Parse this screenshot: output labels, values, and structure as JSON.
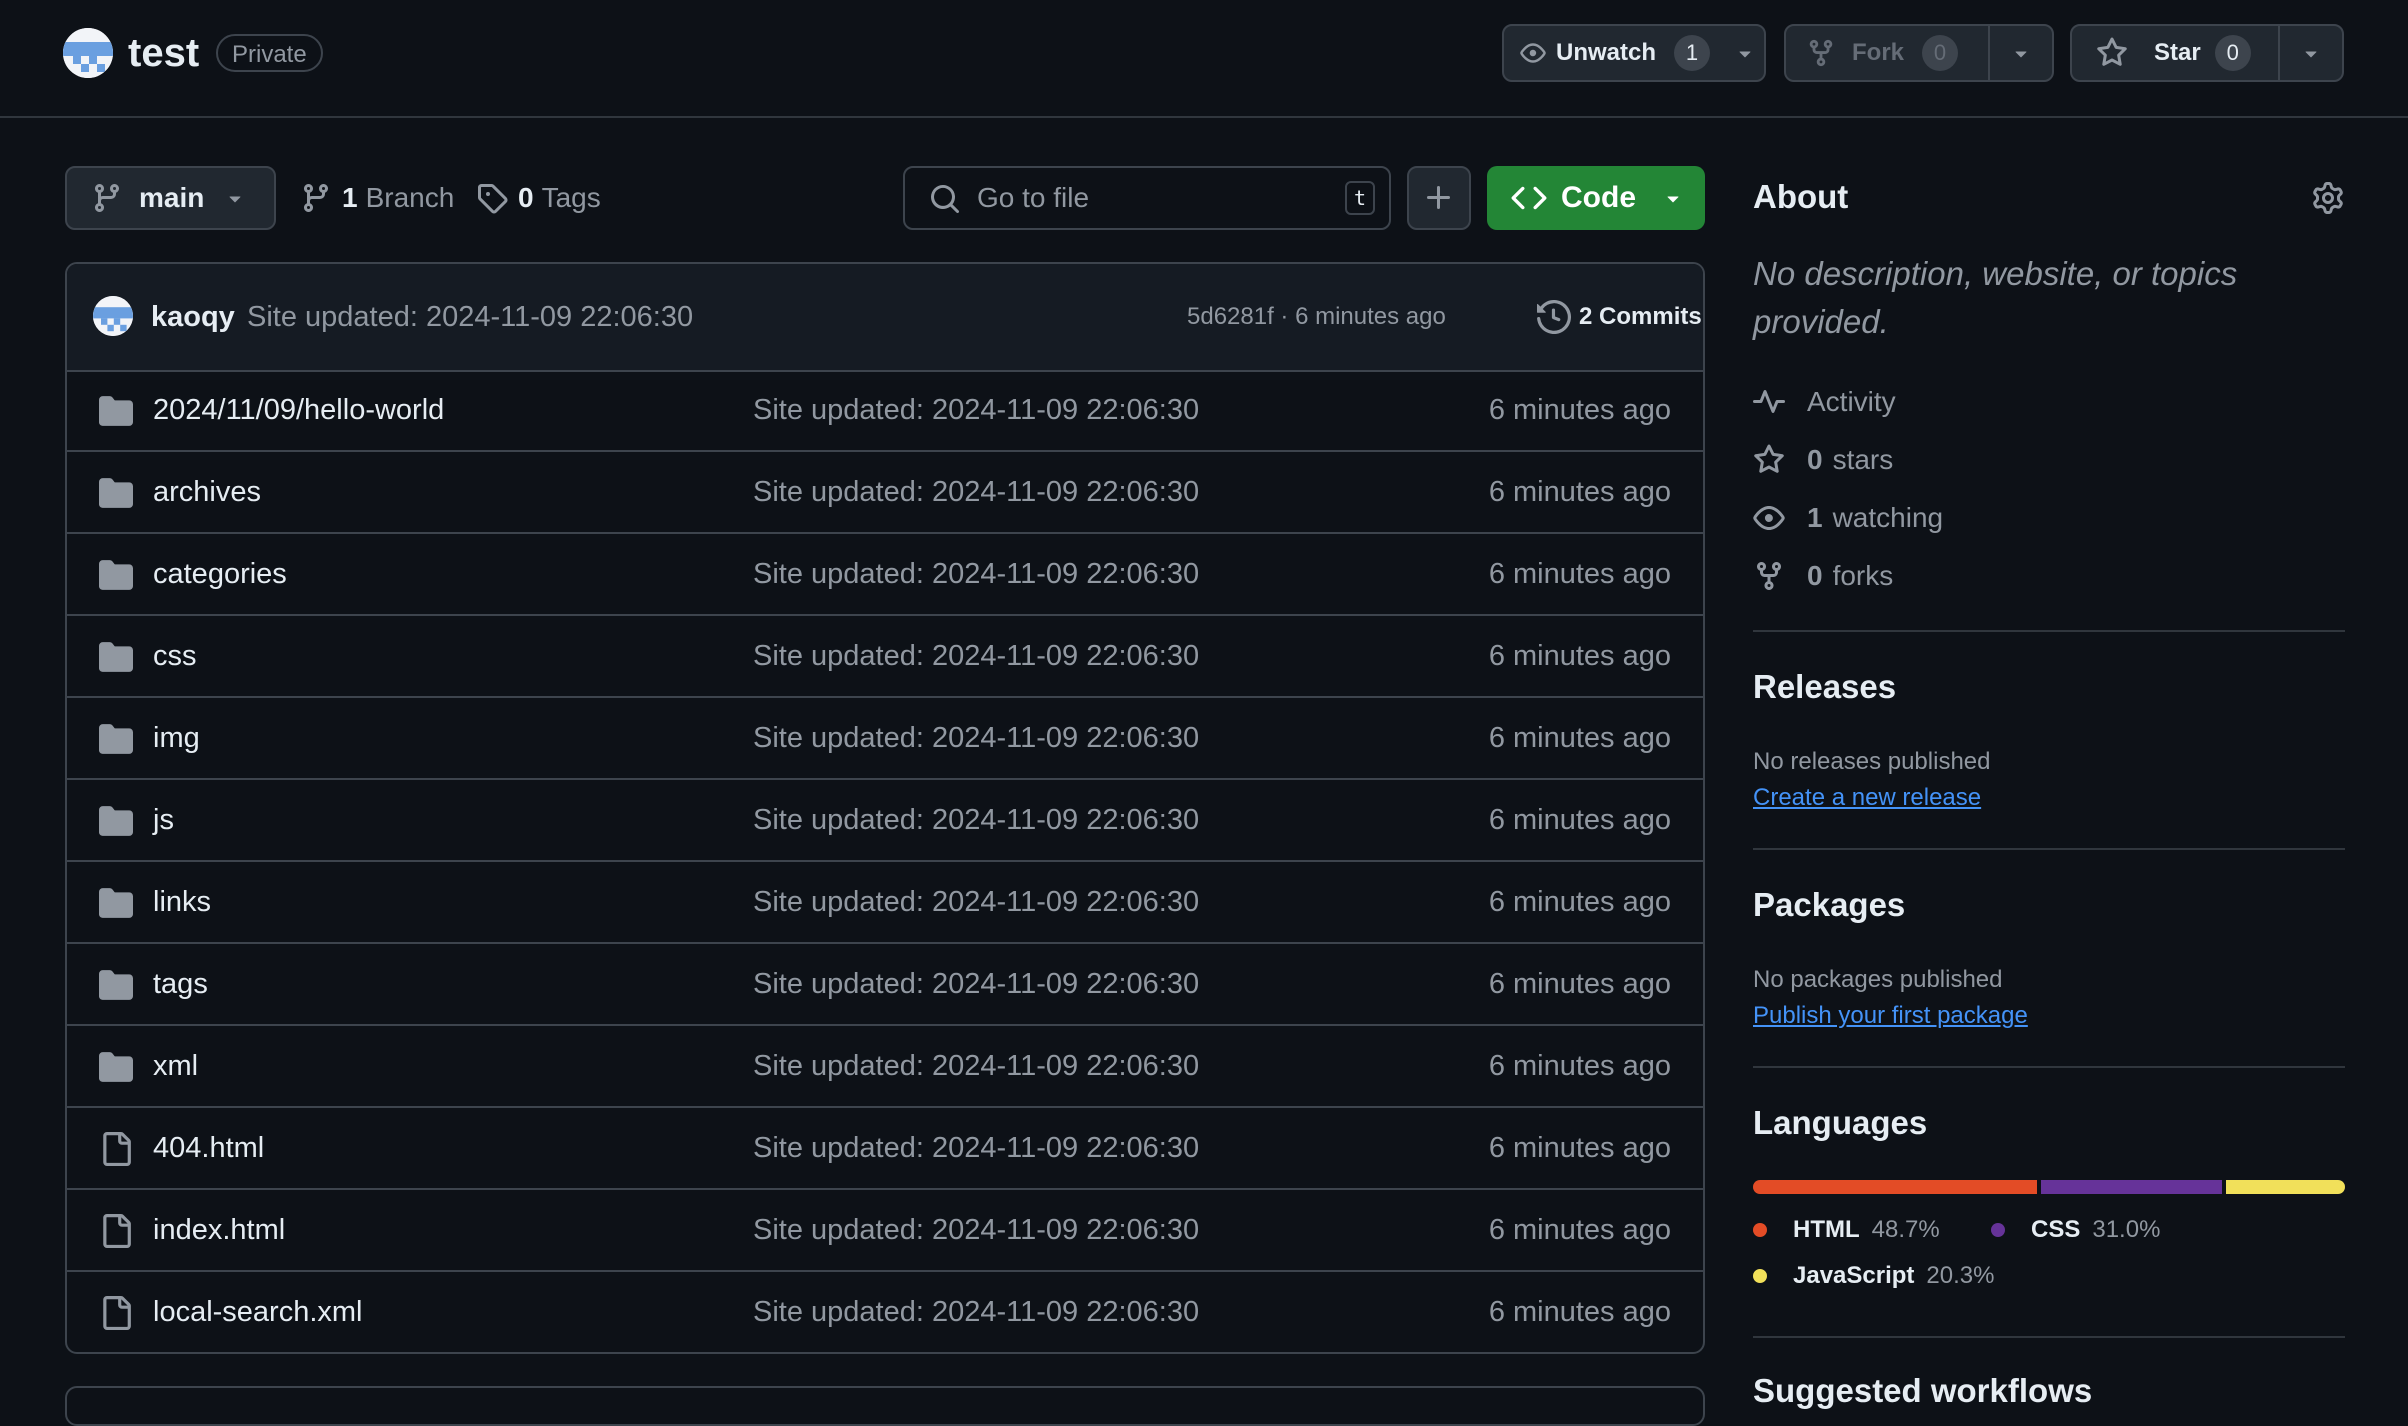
{
  "repo": {
    "name": "test",
    "visibility": "Private"
  },
  "header_actions": {
    "watch": {
      "label": "Unwatch",
      "count": "1"
    },
    "fork": {
      "label": "Fork",
      "count": "0"
    },
    "star": {
      "label": "Star",
      "count": "0"
    }
  },
  "toolbar": {
    "branch": "main",
    "branches_count": "1",
    "branches_label": "Branch",
    "tags_count": "0",
    "tags_label": "Tags",
    "search_placeholder": "Go to file",
    "search_shortcut": "t",
    "code_label": "Code"
  },
  "latest_commit": {
    "author": "kaoqy",
    "message": "Site updated: 2024-11-09 22:06:30",
    "sha": "5d6281f",
    "age": "6 minutes ago",
    "meta": "5d6281f · 6 minutes ago",
    "commits_label": "2 Commits"
  },
  "files": [
    {
      "type": "dir",
      "name": "2024/11/09/hello-world",
      "message": "Site updated: 2024-11-09 22:06:30",
      "age": "6 minutes ago"
    },
    {
      "type": "dir",
      "name": "archives",
      "message": "Site updated: 2024-11-09 22:06:30",
      "age": "6 minutes ago"
    },
    {
      "type": "dir",
      "name": "categories",
      "message": "Site updated: 2024-11-09 22:06:30",
      "age": "6 minutes ago"
    },
    {
      "type": "dir",
      "name": "css",
      "message": "Site updated: 2024-11-09 22:06:30",
      "age": "6 minutes ago"
    },
    {
      "type": "dir",
      "name": "img",
      "message": "Site updated: 2024-11-09 22:06:30",
      "age": "6 minutes ago"
    },
    {
      "type": "dir",
      "name": "js",
      "message": "Site updated: 2024-11-09 22:06:30",
      "age": "6 minutes ago"
    },
    {
      "type": "dir",
      "name": "links",
      "message": "Site updated: 2024-11-09 22:06:30",
      "age": "6 minutes ago"
    },
    {
      "type": "dir",
      "name": "tags",
      "message": "Site updated: 2024-11-09 22:06:30",
      "age": "6 minutes ago"
    },
    {
      "type": "dir",
      "name": "xml",
      "message": "Site updated: 2024-11-09 22:06:30",
      "age": "6 minutes ago"
    },
    {
      "type": "file",
      "name": "404.html",
      "message": "Site updated: 2024-11-09 22:06:30",
      "age": "6 minutes ago"
    },
    {
      "type": "file",
      "name": "index.html",
      "message": "Site updated: 2024-11-09 22:06:30",
      "age": "6 minutes ago"
    },
    {
      "type": "file",
      "name": "local-search.xml",
      "message": "Site updated: 2024-11-09 22:06:30",
      "age": "6 minutes ago"
    }
  ],
  "about": {
    "title": "About",
    "description": "No description, website, or topics provided.",
    "activity_label": "Activity",
    "stars_count": "0",
    "stars_label": "stars",
    "watching_count": "1",
    "watching_label": "watching",
    "forks_count": "0",
    "forks_label": "forks"
  },
  "releases": {
    "title": "Releases",
    "empty": "No releases published",
    "link": "Create a new release"
  },
  "packages": {
    "title": "Packages",
    "empty": "No packages published",
    "link": "Publish your first package"
  },
  "languages": {
    "title": "Languages",
    "items": [
      {
        "name": "HTML",
        "percent": "48.7%",
        "value": 48.7,
        "color": "#e34c26"
      },
      {
        "name": "CSS",
        "percent": "31.0%",
        "value": 31.0,
        "color": "#663399"
      },
      {
        "name": "JavaScript",
        "percent": "20.3%",
        "value": 20.3,
        "color": "#f1e05a"
      }
    ]
  },
  "suggested": {
    "title": "Suggested workflows"
  },
  "colors": {
    "background": "#0d1117",
    "border": "#3d444d",
    "accent_green": "#238636",
    "link": "#4493f8"
  }
}
